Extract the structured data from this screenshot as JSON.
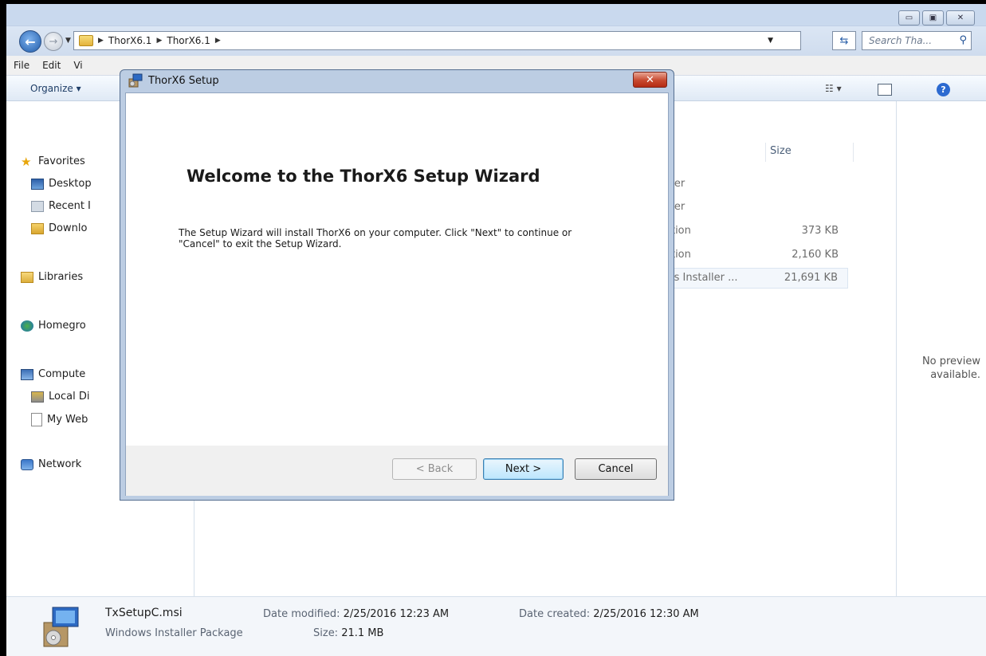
{
  "explorer": {
    "caption_buttons": {
      "minimize": "▭",
      "maximize": "▣",
      "close": "✕"
    },
    "address": {
      "crumbs": [
        "ThorX6.1",
        "ThorX6.1"
      ]
    },
    "search_placeholder": "Search Tha...",
    "menu": [
      "File",
      "Edit",
      "Vi"
    ],
    "organize_label": "Organize ▾",
    "nav": {
      "favorites": "Favorites",
      "desktop": "Desktop",
      "recent": "Recent I",
      "downloads": "Downlo",
      "libraries": "Libraries",
      "homegroup": "Homegro",
      "computer": "Compute",
      "local_disk": "Local Di",
      "my_web": "My Web",
      "network": "Network"
    },
    "columns": {
      "size": "Size"
    },
    "files": [
      {
        "type": "lder",
        "size": ""
      },
      {
        "type": "lder",
        "size": ""
      },
      {
        "type": "ation",
        "size": "373 KB"
      },
      {
        "type": "ation",
        "size": "2,160 KB"
      },
      {
        "type": "ws Installer ...",
        "size": "21,691 KB"
      }
    ],
    "preview_text": [
      "No preview",
      "available."
    ],
    "details": {
      "name": "TxSetupC.msi",
      "type": "Windows Installer Package",
      "modified_label": "Date modified:",
      "modified_value": "2/25/2016 12:23 AM",
      "size_label": "Size:",
      "size_value": "21.1 MB",
      "created_label": "Date created:",
      "created_value": "2/25/2016 12:30 AM"
    }
  },
  "dialog": {
    "title": "ThorX6 Setup",
    "close": "✕",
    "heading": "Welcome to the ThorX6 Setup Wizard",
    "description_line1": "The Setup Wizard will install ThorX6 on your computer.  Click \"Next\" to continue or",
    "description_line2": "\"Cancel\" to exit the Setup Wizard.",
    "back_label": "< Back",
    "next_label": "Next >",
    "cancel_label": "Cancel"
  }
}
